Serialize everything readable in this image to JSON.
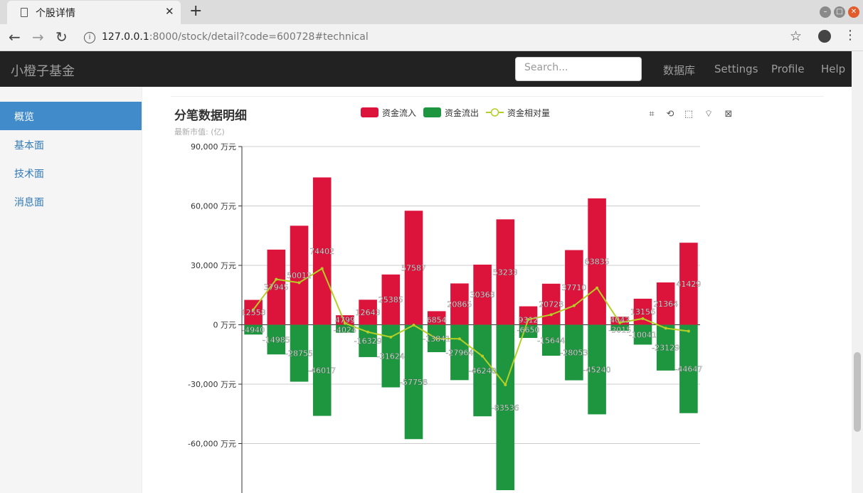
{
  "browser": {
    "tab_title": "个股详情",
    "url_host": "127.0.0.1",
    "url_rest": ":8000/stock/detail?code=600728#technical"
  },
  "navbar": {
    "brand": "小橙子基金",
    "search_placeholder": "Search...",
    "links": [
      "数据库",
      "Settings",
      "Profile",
      "Help"
    ]
  },
  "sidebar": {
    "items": [
      {
        "label": "概览",
        "active": true
      },
      {
        "label": "基本面",
        "active": false
      },
      {
        "label": "技术面",
        "active": false
      },
      {
        "label": "消息面",
        "active": false
      }
    ]
  },
  "chart_data": {
    "type": "bar",
    "title": "分笔数据明细",
    "subtitle": "最新市值: (亿)",
    "unit": "万元",
    "colors": {
      "inflow": "#dc143c",
      "outflow": "#1e9640",
      "relative": "#b5cf26"
    },
    "y_ticks": [
      90000,
      60000,
      30000,
      0,
      -30000,
      -60000
    ],
    "y_tick_labels": [
      "90,000 万元",
      "60,000 万元",
      "30,000 万元",
      "0 万元",
      "-30,000 万元",
      "-60,000 万元"
    ],
    "ylim": [
      -84000,
      90000
    ],
    "grid": true,
    "legend_position": "top-center",
    "series": [
      {
        "name": "资金流入",
        "values": [
          12558,
          37945,
          50012,
          74402,
          4799,
          12643,
          25385,
          57587,
          6854,
          20865,
          30368,
          53233,
          9312,
          20728,
          37710,
          63835,
          4043,
          13156,
          21364,
          41429
        ]
      },
      {
        "name": "资金流出",
        "values": [
          -4940,
          -14985,
          -28755,
          -46017,
          -4024,
          -16329,
          -31624,
          -57758,
          -13841,
          -27964,
          -46240,
          -83536,
          -6650,
          -15644,
          -28053,
          -45240,
          -3015,
          -10041,
          -23129,
          -44647
        ]
      },
      {
        "name": "资金相对量",
        "values": [
          7618,
          22960,
          21257,
          28385,
          775,
          -3686,
          -6239,
          -171,
          -6987,
          -7099,
          -15872,
          -30303,
          2662,
          5084,
          9657,
          18595,
          1028,
          3115,
          -1765,
          -3218
        ]
      }
    ]
  }
}
